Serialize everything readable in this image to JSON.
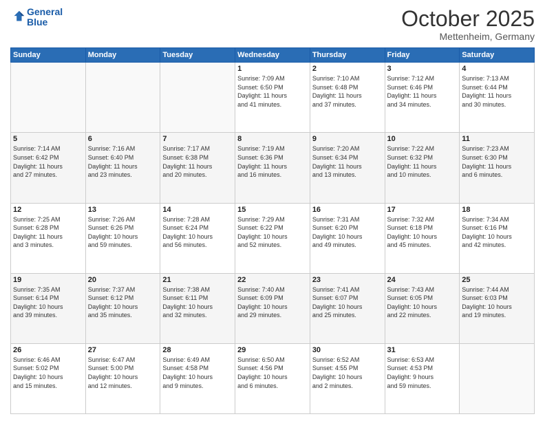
{
  "header": {
    "logo_line1": "General",
    "logo_line2": "Blue",
    "month": "October 2025",
    "location": "Mettenheim, Germany"
  },
  "weekdays": [
    "Sunday",
    "Monday",
    "Tuesday",
    "Wednesday",
    "Thursday",
    "Friday",
    "Saturday"
  ],
  "weeks": [
    [
      {
        "day": "",
        "info": ""
      },
      {
        "day": "",
        "info": ""
      },
      {
        "day": "",
        "info": ""
      },
      {
        "day": "1",
        "info": "Sunrise: 7:09 AM\nSunset: 6:50 PM\nDaylight: 11 hours\nand 41 minutes."
      },
      {
        "day": "2",
        "info": "Sunrise: 7:10 AM\nSunset: 6:48 PM\nDaylight: 11 hours\nand 37 minutes."
      },
      {
        "day": "3",
        "info": "Sunrise: 7:12 AM\nSunset: 6:46 PM\nDaylight: 11 hours\nand 34 minutes."
      },
      {
        "day": "4",
        "info": "Sunrise: 7:13 AM\nSunset: 6:44 PM\nDaylight: 11 hours\nand 30 minutes."
      }
    ],
    [
      {
        "day": "5",
        "info": "Sunrise: 7:14 AM\nSunset: 6:42 PM\nDaylight: 11 hours\nand 27 minutes."
      },
      {
        "day": "6",
        "info": "Sunrise: 7:16 AM\nSunset: 6:40 PM\nDaylight: 11 hours\nand 23 minutes."
      },
      {
        "day": "7",
        "info": "Sunrise: 7:17 AM\nSunset: 6:38 PM\nDaylight: 11 hours\nand 20 minutes."
      },
      {
        "day": "8",
        "info": "Sunrise: 7:19 AM\nSunset: 6:36 PM\nDaylight: 11 hours\nand 16 minutes."
      },
      {
        "day": "9",
        "info": "Sunrise: 7:20 AM\nSunset: 6:34 PM\nDaylight: 11 hours\nand 13 minutes."
      },
      {
        "day": "10",
        "info": "Sunrise: 7:22 AM\nSunset: 6:32 PM\nDaylight: 11 hours\nand 10 minutes."
      },
      {
        "day": "11",
        "info": "Sunrise: 7:23 AM\nSunset: 6:30 PM\nDaylight: 11 hours\nand 6 minutes."
      }
    ],
    [
      {
        "day": "12",
        "info": "Sunrise: 7:25 AM\nSunset: 6:28 PM\nDaylight: 11 hours\nand 3 minutes."
      },
      {
        "day": "13",
        "info": "Sunrise: 7:26 AM\nSunset: 6:26 PM\nDaylight: 10 hours\nand 59 minutes."
      },
      {
        "day": "14",
        "info": "Sunrise: 7:28 AM\nSunset: 6:24 PM\nDaylight: 10 hours\nand 56 minutes."
      },
      {
        "day": "15",
        "info": "Sunrise: 7:29 AM\nSunset: 6:22 PM\nDaylight: 10 hours\nand 52 minutes."
      },
      {
        "day": "16",
        "info": "Sunrise: 7:31 AM\nSunset: 6:20 PM\nDaylight: 10 hours\nand 49 minutes."
      },
      {
        "day": "17",
        "info": "Sunrise: 7:32 AM\nSunset: 6:18 PM\nDaylight: 10 hours\nand 45 minutes."
      },
      {
        "day": "18",
        "info": "Sunrise: 7:34 AM\nSunset: 6:16 PM\nDaylight: 10 hours\nand 42 minutes."
      }
    ],
    [
      {
        "day": "19",
        "info": "Sunrise: 7:35 AM\nSunset: 6:14 PM\nDaylight: 10 hours\nand 39 minutes."
      },
      {
        "day": "20",
        "info": "Sunrise: 7:37 AM\nSunset: 6:12 PM\nDaylight: 10 hours\nand 35 minutes."
      },
      {
        "day": "21",
        "info": "Sunrise: 7:38 AM\nSunset: 6:11 PM\nDaylight: 10 hours\nand 32 minutes."
      },
      {
        "day": "22",
        "info": "Sunrise: 7:40 AM\nSunset: 6:09 PM\nDaylight: 10 hours\nand 29 minutes."
      },
      {
        "day": "23",
        "info": "Sunrise: 7:41 AM\nSunset: 6:07 PM\nDaylight: 10 hours\nand 25 minutes."
      },
      {
        "day": "24",
        "info": "Sunrise: 7:43 AM\nSunset: 6:05 PM\nDaylight: 10 hours\nand 22 minutes."
      },
      {
        "day": "25",
        "info": "Sunrise: 7:44 AM\nSunset: 6:03 PM\nDaylight: 10 hours\nand 19 minutes."
      }
    ],
    [
      {
        "day": "26",
        "info": "Sunrise: 6:46 AM\nSunset: 5:02 PM\nDaylight: 10 hours\nand 15 minutes."
      },
      {
        "day": "27",
        "info": "Sunrise: 6:47 AM\nSunset: 5:00 PM\nDaylight: 10 hours\nand 12 minutes."
      },
      {
        "day": "28",
        "info": "Sunrise: 6:49 AM\nSunset: 4:58 PM\nDaylight: 10 hours\nand 9 minutes."
      },
      {
        "day": "29",
        "info": "Sunrise: 6:50 AM\nSunset: 4:56 PM\nDaylight: 10 hours\nand 6 minutes."
      },
      {
        "day": "30",
        "info": "Sunrise: 6:52 AM\nSunset: 4:55 PM\nDaylight: 10 hours\nand 2 minutes."
      },
      {
        "day": "31",
        "info": "Sunrise: 6:53 AM\nSunset: 4:53 PM\nDaylight: 9 hours\nand 59 minutes."
      },
      {
        "day": "",
        "info": ""
      }
    ]
  ]
}
